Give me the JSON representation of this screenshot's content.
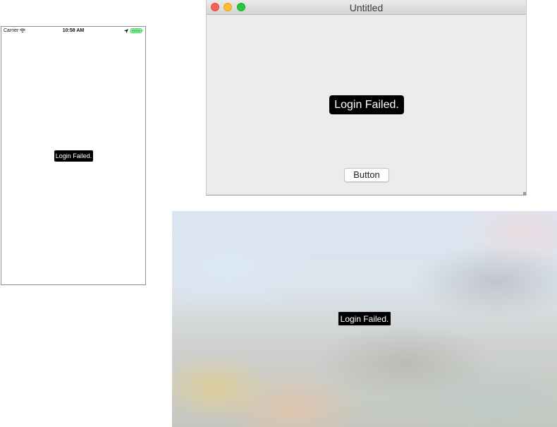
{
  "ios": {
    "status_bar": {
      "carrier": "Carrier",
      "time": "10:58 AM",
      "icons": [
        "wifi-icon",
        "location-icon",
        "battery-icon"
      ],
      "battery_color": "#4cd964"
    },
    "toast": "Login Failed."
  },
  "macos": {
    "window_title": "Untitled",
    "traffic_lights": {
      "close_color": "#fc5f57",
      "minimize_color": "#fdbc2e",
      "zoom_color": "#28c840"
    },
    "toast": "Login Failed.",
    "button_label": "Button"
  },
  "tvos": {
    "toast": "Login Failed."
  }
}
